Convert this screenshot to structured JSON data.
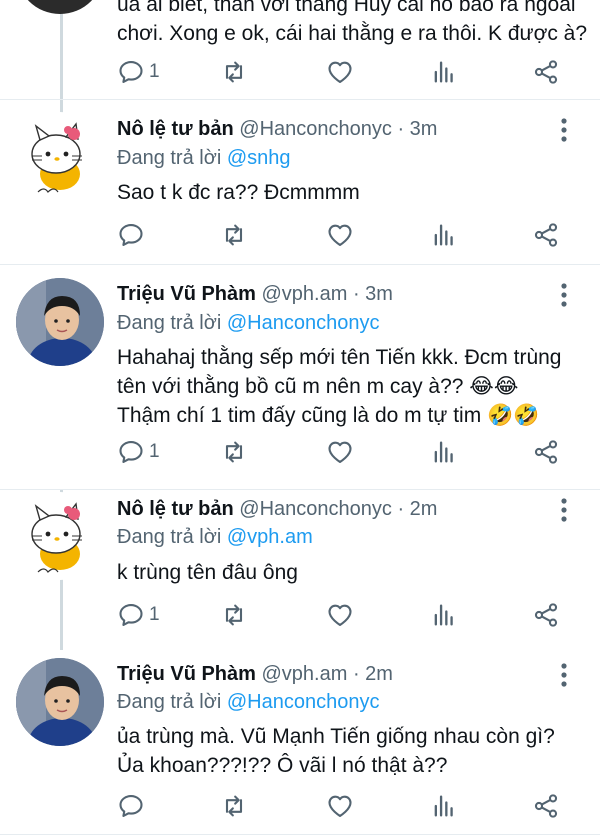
{
  "top_tweet": {
    "text_lines": [
      "ủa ai biết, thân với thằng Huy cái nó bảo ra ngoài",
      "chơi. Xong e ok, cái hai thằng e ra thôi. K được à?"
    ],
    "reply_count": "1"
  },
  "tweets": [
    {
      "name": "Nô lệ tư bản",
      "handle": "@Hanconchonyc",
      "time": "· 3m",
      "replying_label": "Đang trả lời",
      "replying_to": "@snhg",
      "text_lines": [
        "Sao t k đc ra?? Đcmmmm"
      ],
      "reply_count": ""
    },
    {
      "name": "Triệu Vũ Phàm",
      "handle": "@vph.am",
      "time": "· 3m",
      "replying_label": "Đang trả lời",
      "replying_to": "@Hanconchonyc",
      "text_lines": [
        "Hahahaj thằng sếp mới tên Tiến kkk. Đcm trùng",
        "tên với thằng bồ cũ m nên m cay à?? 😂😂",
        "Thậm chí 1 tim đấy cũng là do m tự tim 🤣🤣"
      ],
      "reply_count": "1"
    },
    {
      "name": "Nô lệ tư bản",
      "handle": "@Hanconchonyc",
      "time": "· 2m",
      "replying_label": "Đang trả lời",
      "replying_to": "@vph.am",
      "text_lines": [
        "k trùng tên đâu ông"
      ],
      "reply_count": "1"
    },
    {
      "name": "Triệu Vũ Phàm",
      "handle": "@vph.am",
      "time": "· 2m",
      "replying_label": "Đang trả lời",
      "replying_to": "@Hanconchonyc",
      "text_lines": [
        "ủa trùng mà. Vũ Mạnh Tiến giống nhau còn gì?",
        "Ủa khoan???!?? Ô vãi l nó thật à??"
      ],
      "reply_count": ""
    }
  ],
  "icons": {
    "reply": "reply-icon",
    "retweet": "retweet-icon",
    "like": "heart-icon",
    "stats": "stats-icon",
    "share": "share-icon",
    "more": "more-vertical-icon"
  },
  "colors": {
    "text": "#0f1419",
    "secondary": "#536471",
    "mention": "#1d9bf0",
    "thread_line": "#cfd9de"
  }
}
